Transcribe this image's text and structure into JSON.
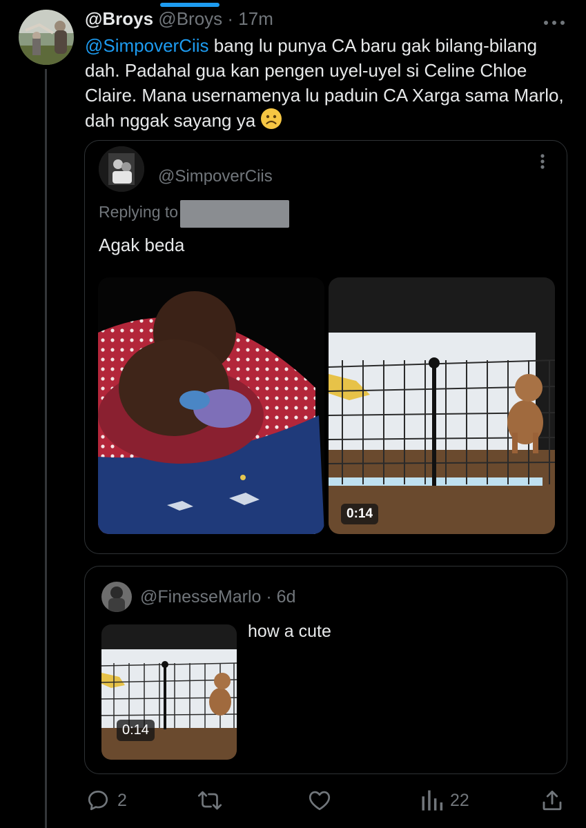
{
  "tweet": {
    "display_name": "@Broys",
    "handle": "@Broys",
    "separator": "·",
    "time": "17m",
    "mention": "@SimpoverCiis",
    "text": " bang lu punya CA baru gak bilang-bilang dah. Padahal gua kan pengen uyel-uyel si Celine Chloe Claire. Mana usernamenya lu paduin CA Xarga sama Marlo, dah nggak sayang ya ",
    "emoji": "sad-face-emoji",
    "more_icon": "more-horizontal-icon"
  },
  "quote": {
    "handle": "@SimpoverCiis",
    "replying_label": "Replying to",
    "text": "Agak beda",
    "video_duration": "0:14",
    "more_icon": "more-vertical-icon"
  },
  "nested_quote": {
    "handle": "@FinesseMarlo",
    "separator": "·",
    "time": "6d",
    "text": "how a cute",
    "video_duration": "0:14"
  },
  "actions": {
    "replies": "2",
    "retweets": "",
    "likes": "",
    "views": "22"
  },
  "colors": {
    "background": "#000000",
    "accent": "#1d9bf0",
    "muted": "#71767b",
    "border": "#2f3336",
    "text": "#e7e9ea"
  }
}
